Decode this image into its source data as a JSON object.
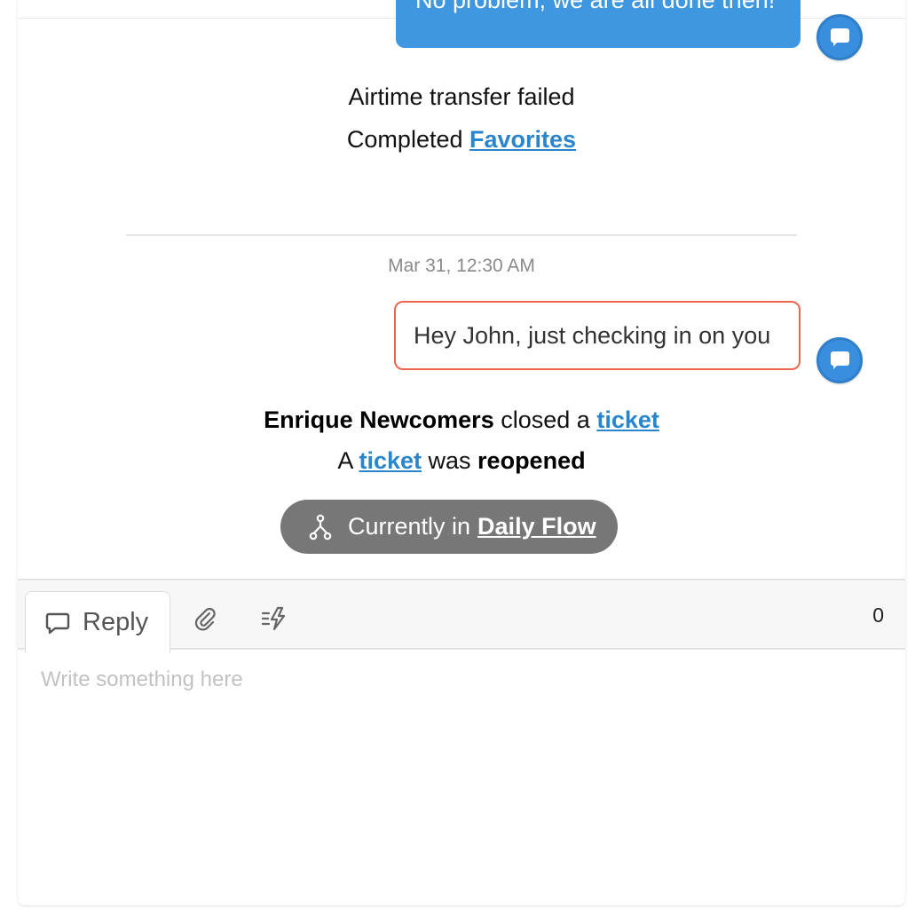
{
  "history": {
    "partial_message": "No problem, we are all done then!",
    "events": {
      "airtime": "Airtime transfer failed",
      "completed_prefix": "Completed",
      "completed_link": "Favorites"
    },
    "timestamp": "Mar 31, 12:30 AM",
    "outgoing_message": "Hey John, just checking in on you",
    "ticket_closed": {
      "actor": "Enrique Newcomers",
      "verb": "closed a",
      "link": "ticket"
    },
    "ticket_reopened": {
      "prefix": "A",
      "link": "ticket",
      "middle": "was",
      "state": "reopened"
    },
    "flow": {
      "prefix": "Currently in",
      "name": "Daily Flow"
    }
  },
  "compose": {
    "reply_tab": "Reply",
    "counter": "0",
    "placeholder": "Write something here"
  },
  "icons": {
    "avatar": "message-bubble-icon",
    "flow": "flow-icon",
    "reply": "chat-bubble-icon",
    "attach": "paperclip-icon",
    "quick_reply": "shortcut-icon"
  },
  "colors": {
    "incoming_bubble": "#3f97e0",
    "outgoing_border": "#f0654f",
    "link": "#2a86cc",
    "flow_pill": "#777777"
  }
}
